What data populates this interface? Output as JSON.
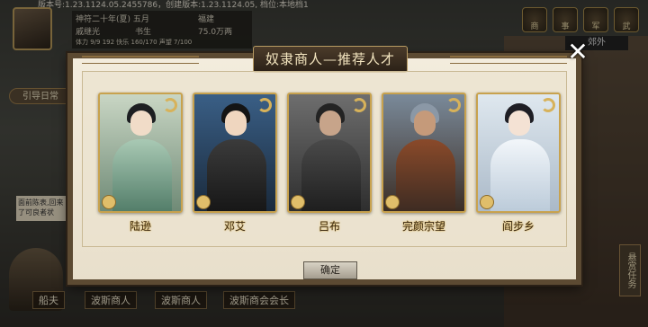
{
  "version_text": "版本号:1.23.1124.05.2455786，创建版本:1.23.1124.05, 档位:本地档1",
  "player": {
    "date": "神符二十年(夏) 五月",
    "rank": "福建",
    "name": "戚继光",
    "title": "书生",
    "money": "75.0万两",
    "stat_line": "体力 9/9 192   快乐 160/170   声望 7/100"
  },
  "top_icons": [
    "商",
    "事",
    "军",
    "武"
  ],
  "area": "郊外",
  "guide_label": "引导日常",
  "note_text": "面前陈表,回来了可良者状",
  "bottom_labels": [
    "船夫",
    "波斯商人",
    "波斯商人",
    "波斯商会会长"
  ],
  "side_button": "悬赏任务",
  "modal": {
    "title": "奴隶商人—推荐人才",
    "confirm_label": "确定",
    "close_symbol": "✕",
    "cards": [
      {
        "name": "陆逊"
      },
      {
        "name": "邓艾"
      },
      {
        "name": "吕布"
      },
      {
        "name": "完颜宗望"
      },
      {
        "name": "阎步乡"
      }
    ]
  },
  "colors": {
    "modal_border": "#5c4a32",
    "card_gold": "#c8a24e",
    "title_text": "#f4e6c0"
  }
}
